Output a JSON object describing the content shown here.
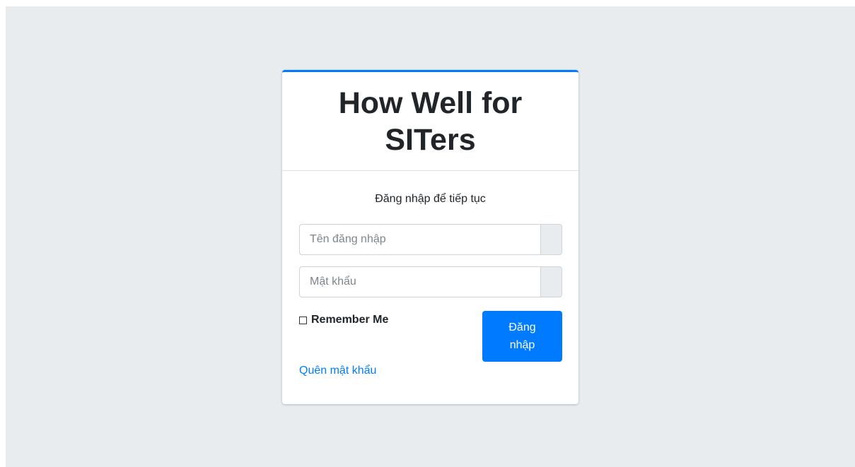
{
  "brand": {
    "title": "How Well for SITers"
  },
  "login": {
    "message": "Đăng nhập để tiếp tục",
    "username_placeholder": "Tên đăng nhập",
    "password_placeholder": "Mật khẩu",
    "remember_label": "Remember Me",
    "submit_label": "Đăng nhập",
    "forgot_label": "Quên mật khẩu"
  },
  "colors": {
    "accent": "#007bff",
    "page_background": "#e9ecef",
    "card_background": "#ffffff"
  }
}
